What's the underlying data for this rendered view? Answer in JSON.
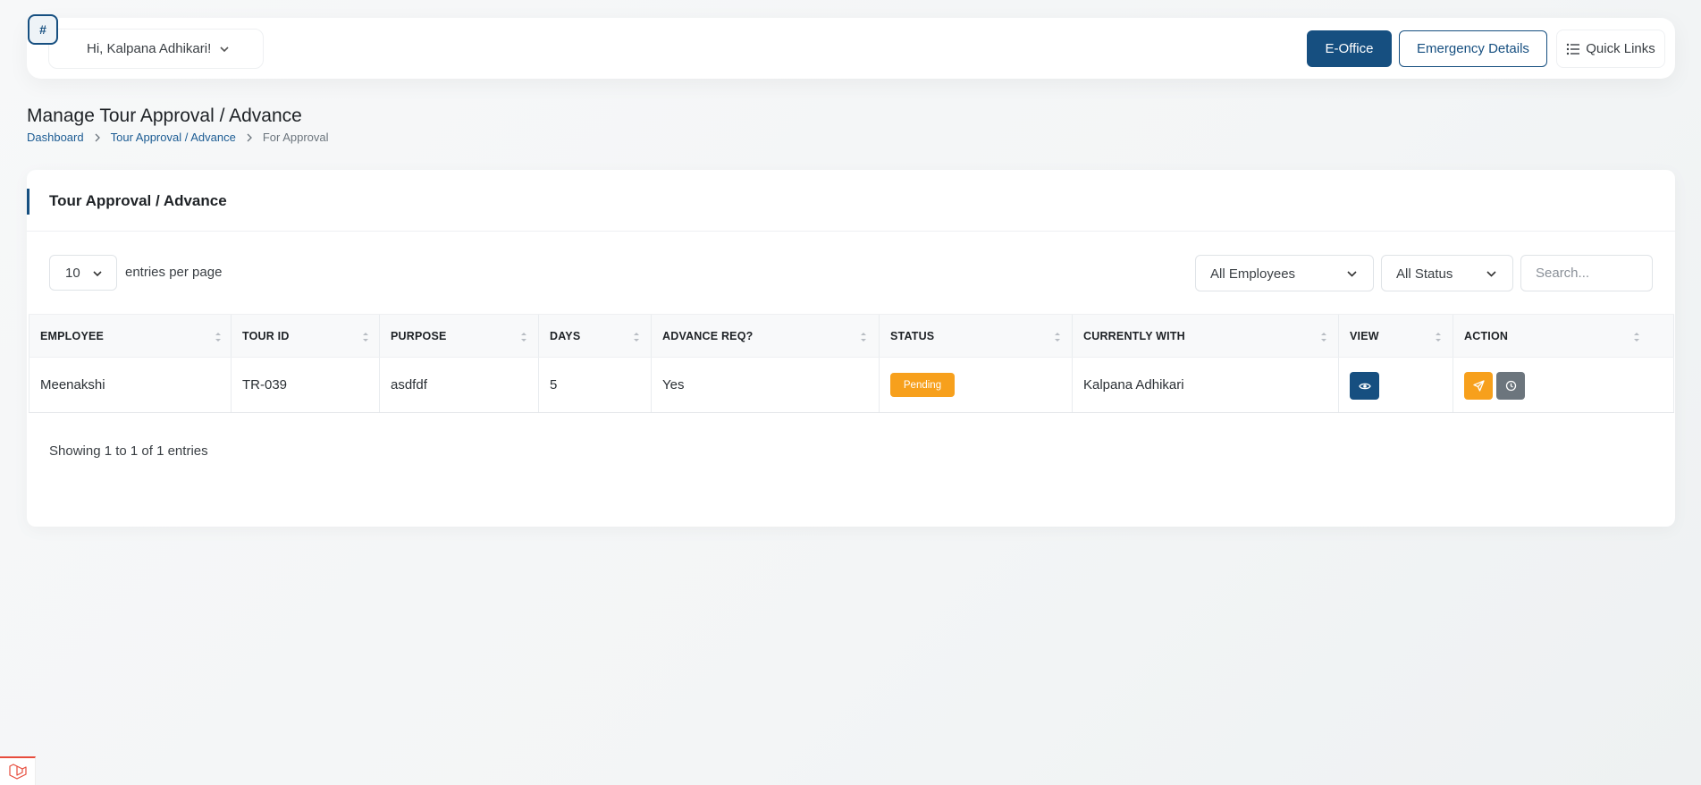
{
  "header": {
    "greeting": "Hi, Kalpana Adhikari!",
    "avatar_text": "#",
    "buttons": {
      "eoffice": "E-Office",
      "emergency": "Emergency Details",
      "quick_links": "Quick Links"
    }
  },
  "page": {
    "title": "Manage Tour Approval / Advance",
    "breadcrumb": [
      "Dashboard",
      "Tour Approval / Advance",
      "For Approval"
    ]
  },
  "card": {
    "title": "Tour Approval / Advance",
    "entries_value": "10",
    "entries_label": "entries per page",
    "filters": {
      "employee": "All Employees",
      "status": "All Status",
      "search_placeholder": "Search..."
    },
    "columns": [
      "EMPLOYEE",
      "TOUR ID",
      "PURPOSE",
      "DAYS",
      "ADVANCE REQ?",
      "STATUS",
      "CURRENTLY WITH",
      "VIEW",
      "ACTION"
    ],
    "rows": [
      {
        "employee": "Meenakshi",
        "tour_id": "TR-039",
        "purpose": "asdfdf",
        "days": "5",
        "advance": "Yes",
        "status": "Pending",
        "currently_with": "Kalpana Adhikari"
      }
    ],
    "footer": "Showing 1 to 1 of 1 entries"
  },
  "colors": {
    "primary": "#164f80",
    "pending": "#f7a01c",
    "history": "#6c757d"
  }
}
